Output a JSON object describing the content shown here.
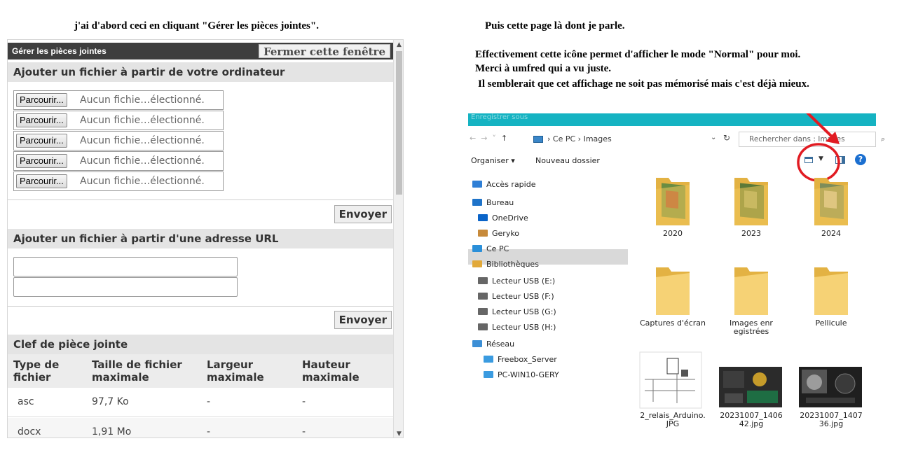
{
  "captions": {
    "left": "j'ai d'abord ceci en cliquant \"Gérer les pièces jointes\".",
    "right_top": "Puis cette page là dont je parle.",
    "right_line1": "Effectivement cette icône permet d'afficher le mode \"Normal\" pour moi.",
    "right_line2": "Merci à  umfred qui a vu juste.",
    "right_line3": "Il semblerait que cet affichage ne soit pas mémorisé mais c'est déjà mieux."
  },
  "attachments": {
    "title": "Gérer les pièces jointes",
    "close_label": "Fermer cette fenêtre",
    "computer_section": "Ajouter un fichier à partir de votre ordinateur",
    "browse_label": "Parcourir...",
    "no_file_text": "Aucun fichie…électionné.",
    "send_label": "Envoyer",
    "url_section": "Ajouter un fichier à partir d'une adresse URL",
    "key_section": "Clef de pièce jointe",
    "table_headers": [
      "Type de fichier",
      "Taille de fichier maximale",
      "Largeur maximale",
      "Hauteur maximale"
    ],
    "rows": [
      [
        "asc",
        "97,7 Ko",
        "-",
        "-"
      ],
      [
        "docx",
        "1,91 Mo",
        "-",
        "-"
      ]
    ]
  },
  "explorer": {
    "titlebar_text": "Enregistrer sous",
    "breadcrumb": [
      "Ce PC",
      "Images"
    ],
    "search_placeholder": "Rechercher dans : Images",
    "toolbar": {
      "organize": "Organiser ▾",
      "new_folder": "Nouveau dossier"
    },
    "nav_items": [
      {
        "label": "Accès rapide",
        "icon": "star-icon",
        "color": "#2f7fd6"
      },
      {
        "label": "Bureau",
        "icon": "desktop-icon",
        "color": "#1e73c9"
      },
      {
        "label": "OneDrive",
        "icon": "cloud-icon",
        "color": "#0a64c8"
      },
      {
        "label": "Geryko",
        "icon": "user-icon",
        "color": "#c78a3a"
      },
      {
        "label": "Ce PC",
        "icon": "computer-icon",
        "color": "#2a8fd9"
      },
      {
        "label": "Bibliothèques",
        "icon": "library-icon",
        "color": "#e2a93a"
      },
      {
        "label": "Lecteur USB (E:)",
        "icon": "drive-icon",
        "color": "#666666"
      },
      {
        "label": "Lecteur USB (F:)",
        "icon": "drive-icon",
        "color": "#666666"
      },
      {
        "label": "Lecteur USB (G:)",
        "icon": "drive-icon",
        "color": "#666666"
      },
      {
        "label": "Lecteur USB (H:)",
        "icon": "drive-icon",
        "color": "#666666"
      },
      {
        "label": "Réseau",
        "icon": "network-icon",
        "color": "#3c8fd6"
      },
      {
        "label": "Freebox_Server",
        "icon": "monitor-icon",
        "color": "#3a9be0"
      },
      {
        "label": "PC-WIN10-GERY",
        "icon": "monitor-icon",
        "color": "#3a9be0"
      }
    ],
    "items": [
      {
        "label": "2020"
      },
      {
        "label": "2023"
      },
      {
        "label": "2024"
      },
      {
        "label": "Captures d'écran"
      },
      {
        "label": "Images enregistrées"
      },
      {
        "label": "Pellicule"
      },
      {
        "label": "2_relais_Arduino.JPG"
      },
      {
        "label": "20231007_140642.jpg"
      },
      {
        "label": "20231007_140736.jpg"
      }
    ],
    "highlight_color": "#e11b22"
  }
}
